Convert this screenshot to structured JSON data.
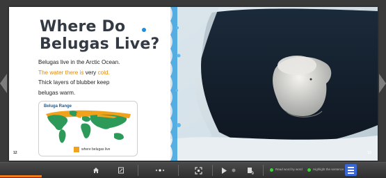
{
  "book": {
    "title_line1": "Where Do",
    "title_line2": "Belugas Live?",
    "body": {
      "line1": "Belugas live in the Arctic Ocean.",
      "line2_orange_a": "The water there is",
      "line2_plain": " very ",
      "line2_orange_b": "cold.",
      "line3": "Thick layers of blubber keep",
      "line4": "belugas warm."
    },
    "map": {
      "title": "Beluga Range",
      "legend_label": "where belugas live",
      "range_color": "#f0a21c",
      "land_color": "#2e9a59",
      "water_color": "#ffffff"
    },
    "page_left": "12",
    "page_right": "13"
  },
  "toolbar": {
    "icons": [
      "home-icon",
      "notes-icon",
      "page-dots-icon",
      "fullscreen-icon",
      "play-icon",
      "record-icon",
      "read-aloud-icon",
      "menu-icon"
    ],
    "status1_label": "Read word by word",
    "status2_label": "Highlight the sentence",
    "accent_color": "#3a67d8",
    "status_color": "#3dd23d"
  }
}
